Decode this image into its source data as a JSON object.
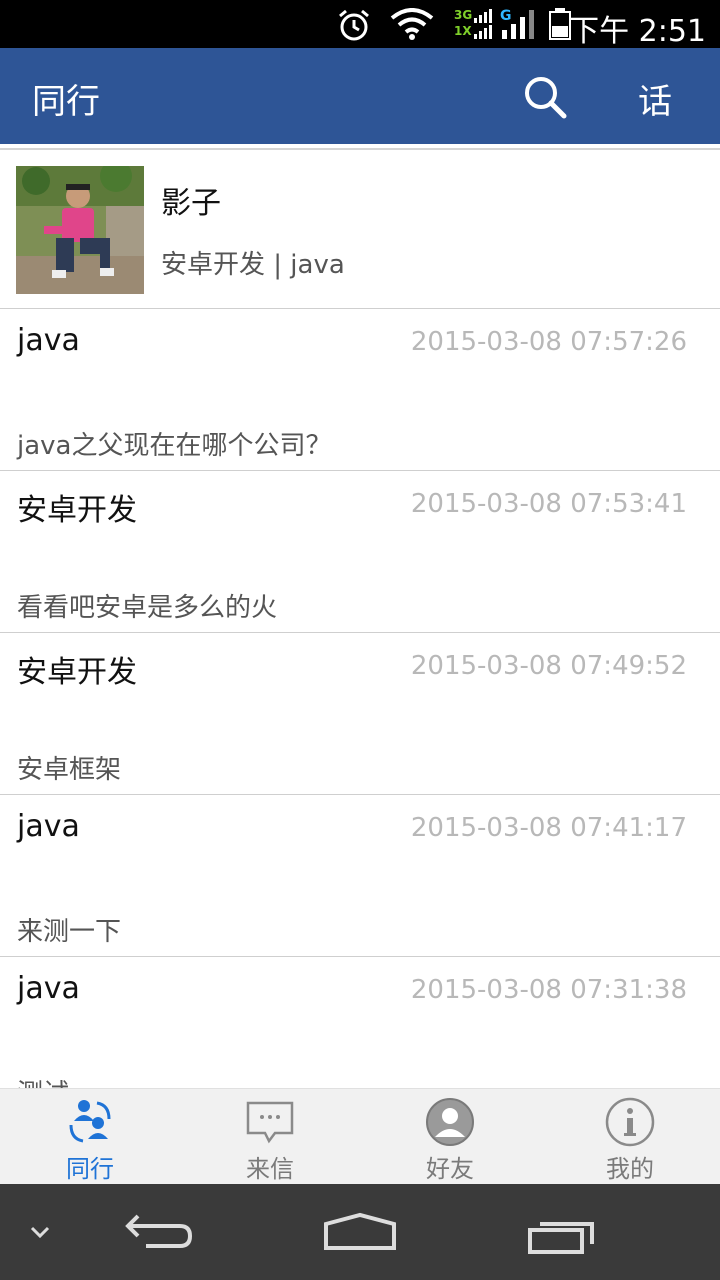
{
  "status": {
    "time": "下午 2:51",
    "net1": "3G",
    "net2": "1X",
    "net3": "G"
  },
  "appbar": {
    "title": "同行",
    "talk_label": "话"
  },
  "profile": {
    "name": "影子",
    "subtitle": "安卓开发 | java"
  },
  "posts": [
    {
      "author": "java",
      "time": "2015-03-08 07:57:26",
      "content": "java之父现在在哪个公司？"
    },
    {
      "author": "安卓开发",
      "time": "2015-03-08 07:53:41",
      "content": "看看吧安卓是多么的火"
    },
    {
      "author": "安卓开发",
      "time": "2015-03-08 07:49:52",
      "content": "安卓框架"
    },
    {
      "author": "java",
      "time": "2015-03-08 07:41:17",
      "content": "来测一下"
    },
    {
      "author": "java",
      "time": "2015-03-08 07:31:38",
      "content": "测试"
    }
  ],
  "tabs": [
    {
      "label": "同行",
      "icon": "colleagues-icon",
      "active": true
    },
    {
      "label": "来信",
      "icon": "message-icon",
      "active": false
    },
    {
      "label": "好友",
      "icon": "friend-icon",
      "active": false
    },
    {
      "label": "我的",
      "icon": "info-icon",
      "active": false
    }
  ],
  "colors": {
    "appbar": "#2e5596",
    "active_tab": "#1f73d6",
    "timestamp": "#b8b8b8"
  }
}
